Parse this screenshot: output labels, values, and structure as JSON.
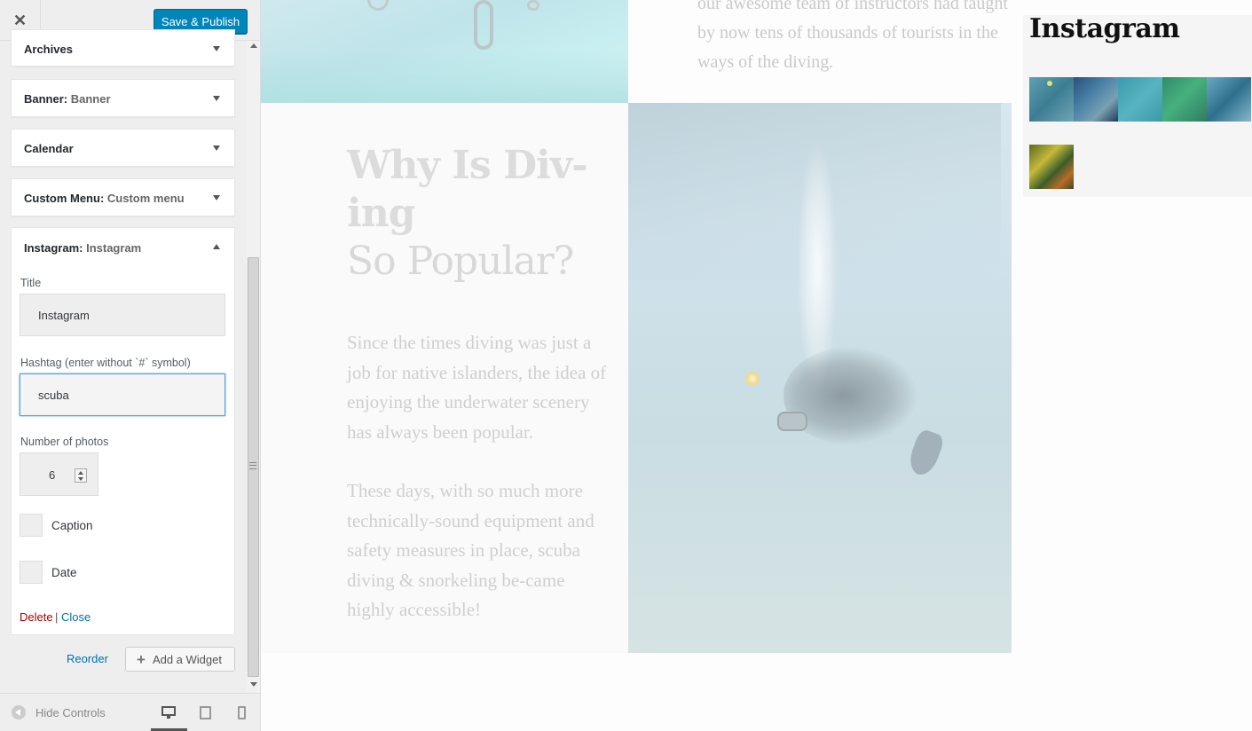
{
  "topbar": {
    "close_icon": "close-icon",
    "publish_label": "Save & Publish"
  },
  "widgets": [
    {
      "title": "Archives",
      "subtitle": ""
    },
    {
      "title": "Banner:",
      "subtitle": "Banner"
    },
    {
      "title": "Calendar",
      "subtitle": ""
    },
    {
      "title": "Custom Menu:",
      "subtitle": "Custom menu"
    }
  ],
  "instagram_widget": {
    "title": "Instagram:",
    "subtitle": "Instagram",
    "fields": {
      "title_label": "Title",
      "title_value": "Instagram",
      "hashtag_label": "Hashtag (enter without `#` symbol)",
      "hashtag_value": "scuba",
      "photos_label": "Number of photos",
      "photos_value": "6",
      "caption_label": "Caption",
      "caption_checked": false,
      "date_label": "Date",
      "date_checked": false
    },
    "delete_label": "Delete",
    "separator": "|",
    "close_label": "Close"
  },
  "actions": {
    "reorder_label": "Reorder",
    "add_widget_label": "Add a Widget",
    "add_icon": "plus-icon"
  },
  "footer": {
    "hide_label": "Hide Controls",
    "hide_icon": "collapse-arrow-icon",
    "devices": [
      "desktop-icon",
      "tablet-icon",
      "mobile-icon"
    ],
    "active_device": "desktop"
  },
  "preview": {
    "top_paragraph": "our awesome team of instructors had taught by now tens of thousands of tourists in the ways of the diving.",
    "heading_line1": "Why Is Div-",
    "heading_line2": "ing",
    "heading_line3": "So Popular?",
    "paragraph_1": "Since the times diving was just a job for native islanders, the idea of enjoying the underwater scenery has always been popular.",
    "paragraph_2": "These days, with so much more technically-sound equipment and safety measures in place, scuba diving & snorkeling be-came highly accessible!",
    "sidebar_widget_title": "Instagram",
    "thumbnail_count": 6
  },
  "colors": {
    "primary_button": "#0085ba",
    "link": "#0073aa",
    "delete": "#aa0000",
    "focus_border": "#5b9dd9"
  }
}
